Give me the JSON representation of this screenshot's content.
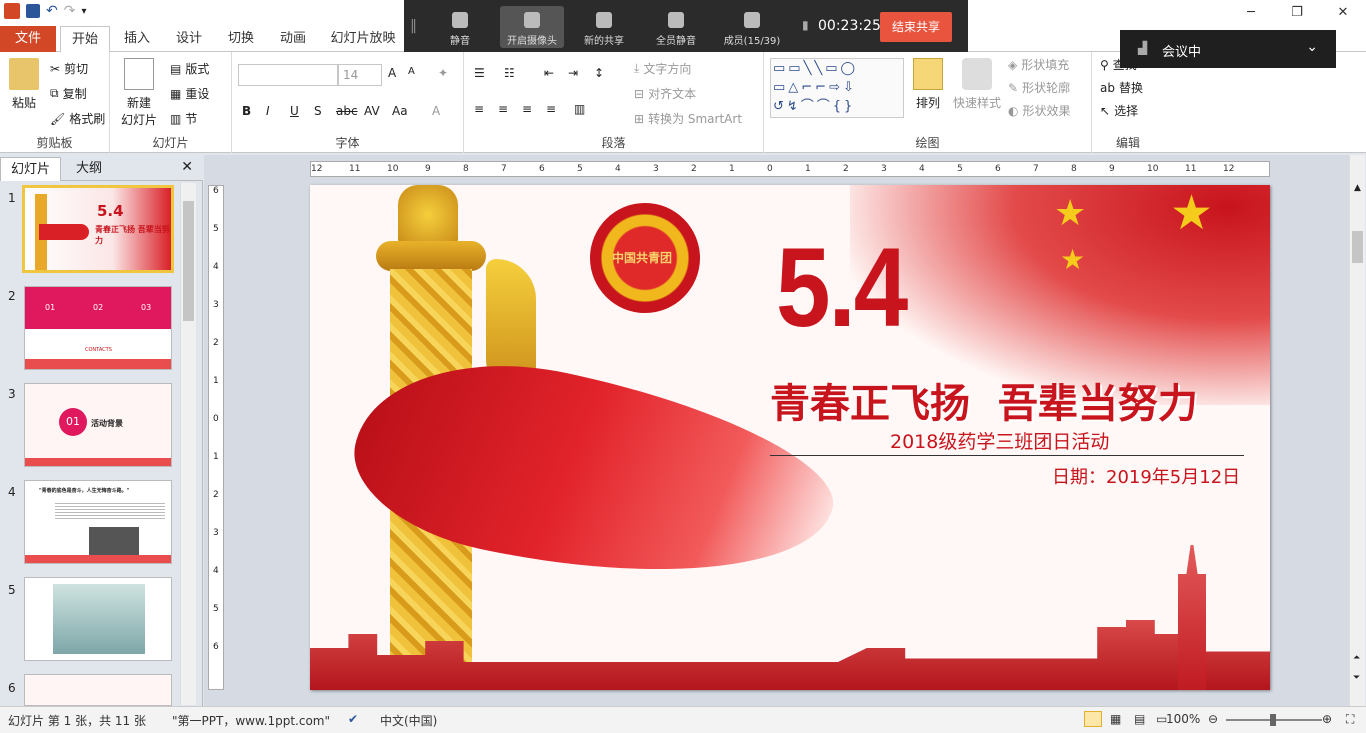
{
  "app": {
    "title_icon": "powerpoint-icon"
  },
  "window": {
    "minimize": "─",
    "restore": "❐",
    "close": "✕"
  },
  "tabs": {
    "file": "文件",
    "home": "开始",
    "insert": "插入",
    "design": "设计",
    "transitions": "切换",
    "animations": "动画",
    "slideshow": "幻灯片放映"
  },
  "ribbon": {
    "clipboard": {
      "label": "剪贴板",
      "paste": "粘贴",
      "cut": "剪切",
      "copy": "复制",
      "format_painter": "格式刷"
    },
    "slides": {
      "label": "幻灯片",
      "new_slide": "新建",
      "new_slide2": "幻灯片",
      "layout": "版式",
      "reset": "重设",
      "section": "节"
    },
    "font": {
      "label": "字体",
      "font_name": "",
      "font_size": "14"
    },
    "paragraph": {
      "label": "段落",
      "text_direction": "文字方向",
      "align_text": "对齐文本",
      "smartart": "转换为 SmartArt"
    },
    "drawing": {
      "label": "绘图",
      "arrange": "排列",
      "quick_styles": "快速样式",
      "shape_fill": "形状填充",
      "shape_outline": "形状轮廓",
      "shape_effects": "形状效果"
    },
    "editing": {
      "label": "编辑",
      "find": "查找",
      "replace": "替换",
      "select": "选择"
    }
  },
  "meeting": {
    "mute": "静音",
    "camera": "开启摄像头",
    "share": "新的共享",
    "mute_all": "全员静音",
    "members": "成员(15/39)",
    "timer": "00:23:25",
    "end_share": "结束共享",
    "status": "会议中"
  },
  "panes": {
    "slides_tab": "幻灯片",
    "outline_tab": "大纲"
  },
  "thumbnails": [
    {
      "num": "1",
      "title": "5.4",
      "sub": "青春正飞扬  吾辈当努力"
    },
    {
      "num": "2",
      "a": "01",
      "b": "02",
      "c": "03",
      "contacts": "CONTACTS"
    },
    {
      "num": "3",
      "badge": "01",
      "text": "活动背景"
    },
    {
      "num": "4",
      "text": "\"青春的底色是奋斗，人生无悔奋斗路。\""
    },
    {
      "num": "5"
    },
    {
      "num": "6"
    }
  ],
  "ruler": {
    "h": [
      "12",
      "11",
      "10",
      "9",
      "8",
      "7",
      "6",
      "5",
      "4",
      "3",
      "2",
      "1",
      "0",
      "1",
      "2",
      "3",
      "4",
      "5",
      "6",
      "7",
      "8",
      "9",
      "10",
      "11",
      "12"
    ],
    "v": [
      "6",
      "5",
      "4",
      "3",
      "2",
      "1",
      "0",
      "1",
      "2",
      "3",
      "4",
      "5",
      "6"
    ]
  },
  "slide": {
    "number": "5.4",
    "headline": "青春正飞扬  吾辈当努力",
    "subtitle": "2018级药学三班团日活动",
    "date": "日期：2019年5月12日",
    "badge_text": "中国共青团"
  },
  "status": {
    "slide_info": "幻灯片 第 1 张，共 11 张",
    "theme": "\"第一PPT，www.1ppt.com\"",
    "language": "中文(中国)",
    "zoom": "100%"
  },
  "colors": {
    "accent": "#d24726",
    "slide_red": "#c8141c",
    "meeting_end": "#e8543e",
    "gold": "#f0b81c"
  }
}
